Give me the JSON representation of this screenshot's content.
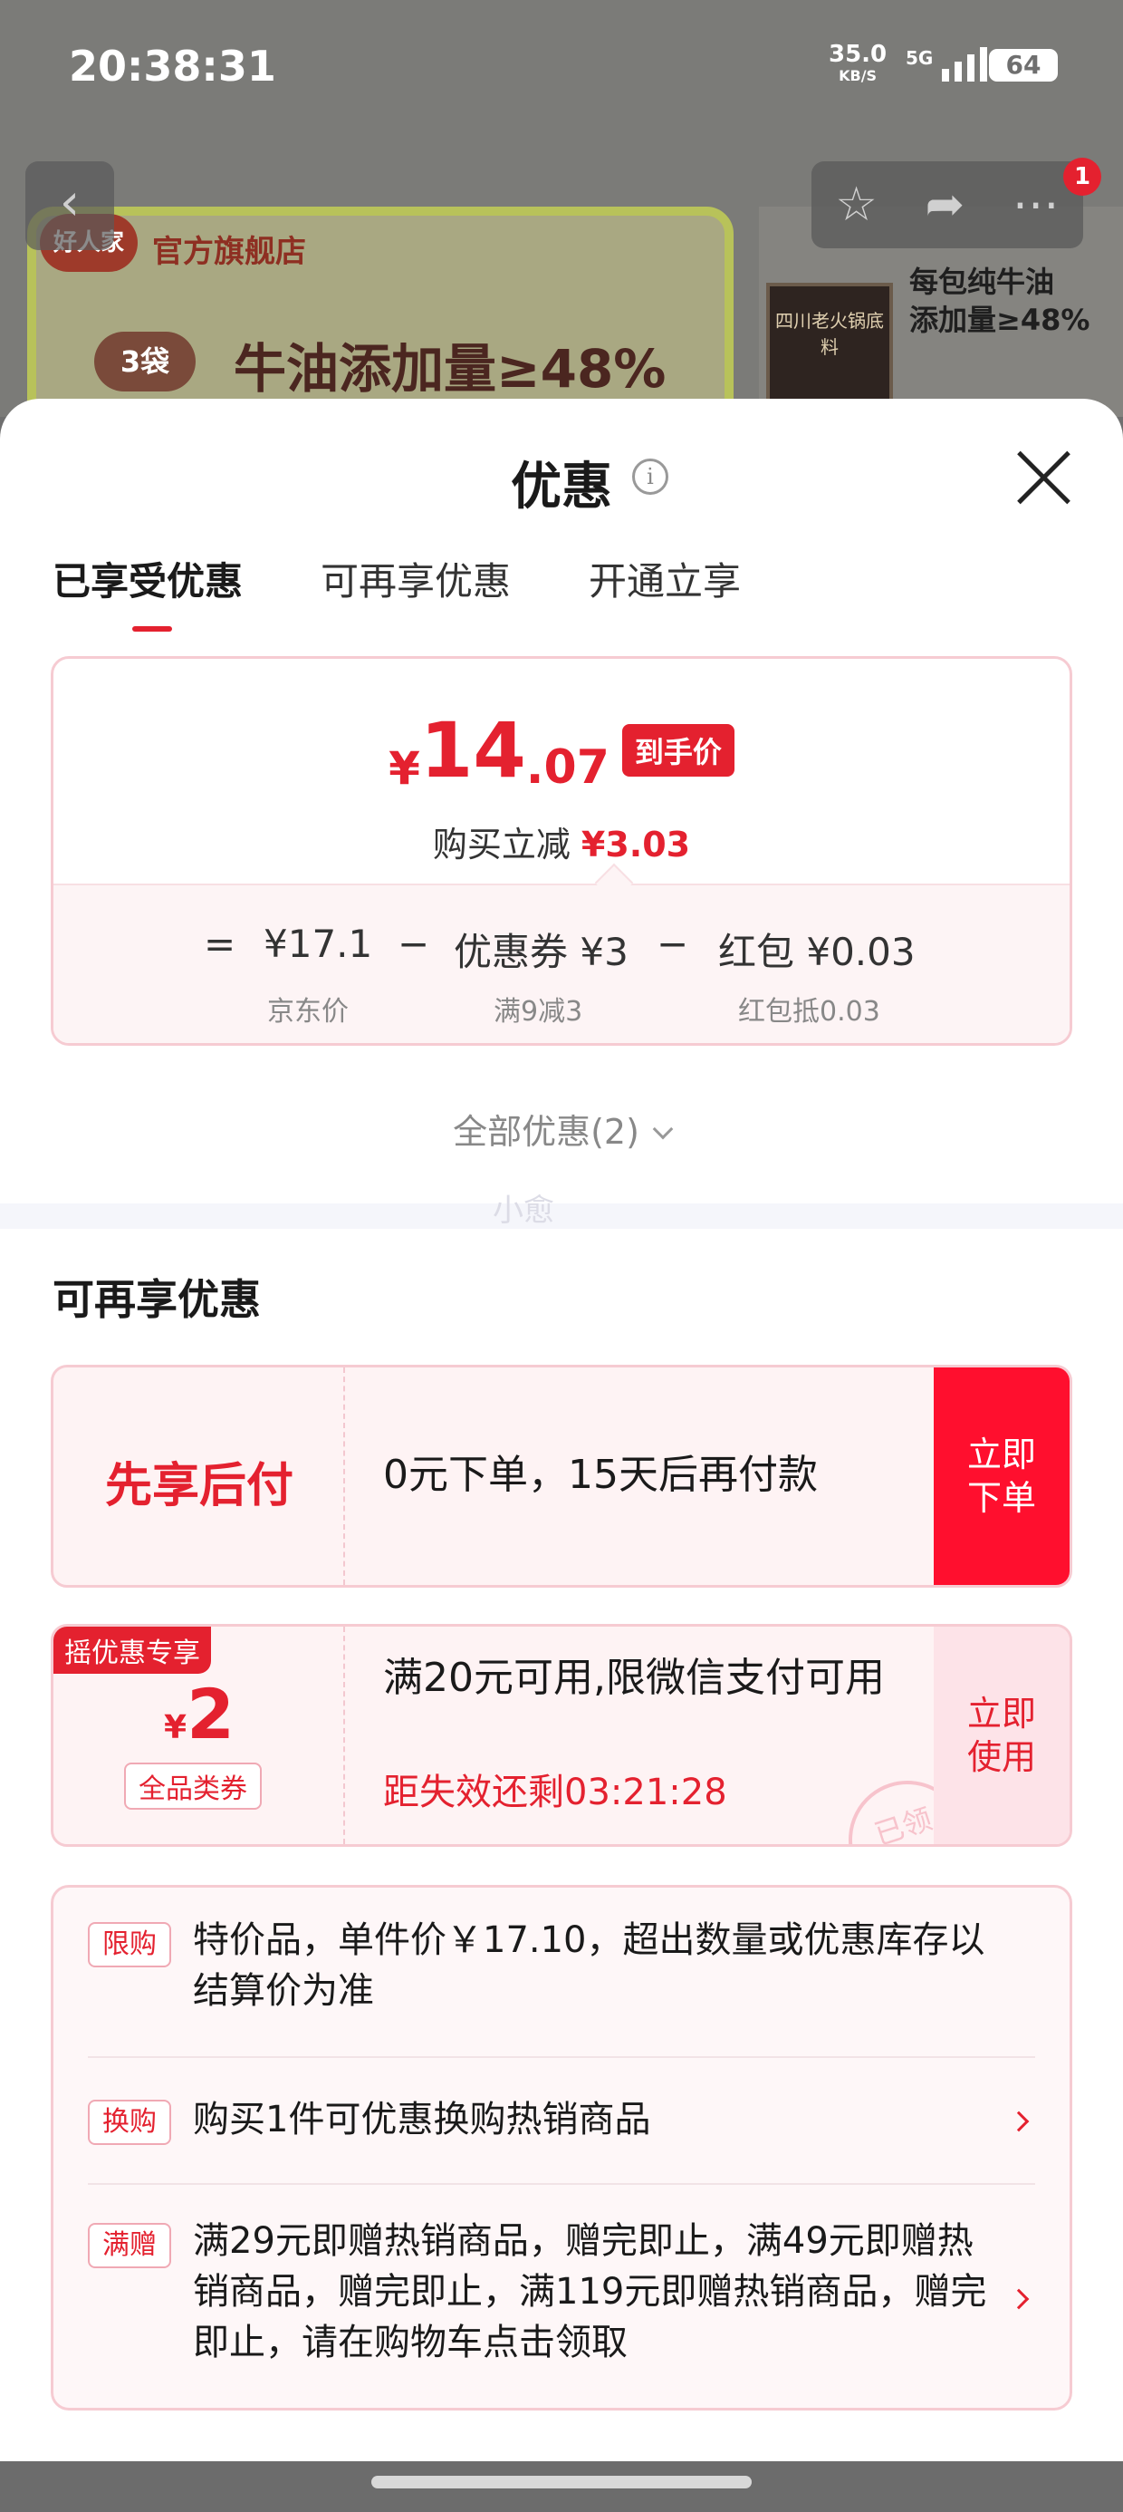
{
  "status_bar": {
    "time": "20:38:31",
    "net_speed": "35.0",
    "net_unit": "KB/S",
    "network": "5G",
    "battery": "64"
  },
  "background_page": {
    "store_logo": "好人家",
    "store_label": "官方旗舰店",
    "bag_count": "3袋",
    "headline": "牛油添加量≥48%",
    "side_text_1": "每包纯牛油",
    "side_text_2": "添加量≥48%",
    "pack_label": "四川老火锅底料",
    "cart_badge": "1"
  },
  "sheet": {
    "title": "优惠",
    "tabs": [
      "已享受优惠",
      "可再享优惠",
      "开通立享"
    ],
    "active_tab": 0
  },
  "price_card": {
    "currency": "¥",
    "price_int": "14",
    "price_dec": ".07",
    "final_tag": "到手价",
    "reduce_label": "购买立减",
    "reduce_value": "¥3.03",
    "breakdown": {
      "eq": "=",
      "base": "¥17.1",
      "base_label": "京东价",
      "minus1": "−",
      "coupon": "优惠券 ¥3",
      "coupon_label": "满9减3",
      "minus2": "−",
      "redpacket": "红包 ¥0.03",
      "redpacket_label": "红包抵0.03"
    }
  },
  "all_offers": "全部优惠(2)",
  "watermark": "小愈",
  "more_offers": {
    "title": "可再享优惠",
    "bnpl": {
      "label": "先享后付",
      "desc": "0元下单，15天后再付款",
      "cta_line1": "立即",
      "cta_line2": "下单"
    },
    "coupon": {
      "ribbon": "摇优惠专享",
      "currency": "¥",
      "amount": "2",
      "scope": "全品类券",
      "desc": "满20元可用,限微信支付可用",
      "countdown": "距失效还剩03:21:28",
      "cta_line1": "立即",
      "cta_line2": "使用",
      "stamp": "已领"
    }
  },
  "promos": [
    {
      "tag": "限购",
      "text": "特价品，单件价￥17.10，超出数量或优惠库存以结算价为准"
    },
    {
      "tag": "换购",
      "text": "购买1件可优惠换购热销商品"
    },
    {
      "tag": "满赠",
      "text": "满29元即赠热销商品，赠完即止，满49元即赠热销商品，赠完即止，满119元即赠热销商品，赠完即止，请在购物车点击领取"
    }
  ]
}
